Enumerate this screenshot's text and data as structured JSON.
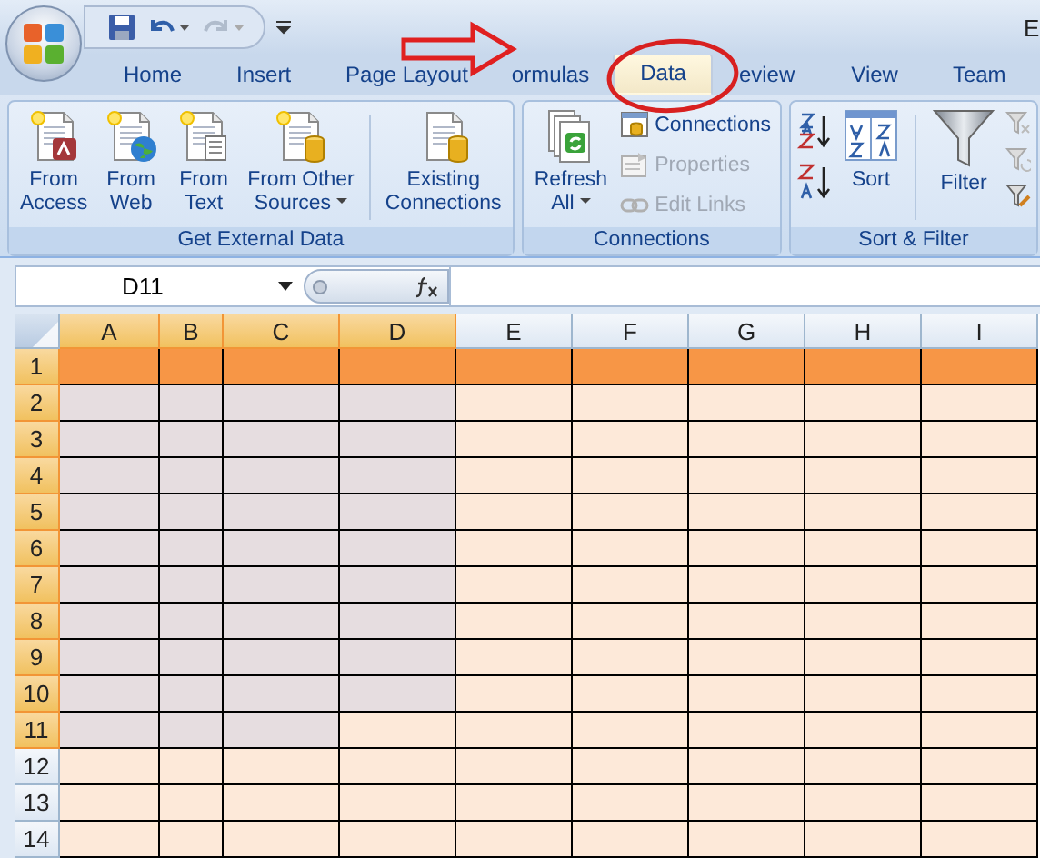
{
  "title_bar": {
    "title": "E"
  },
  "tabs": [
    {
      "label": "Home",
      "selected": false
    },
    {
      "label": "Insert",
      "selected": false
    },
    {
      "label": "Page Layout",
      "selected": false
    },
    {
      "label": "ormulas",
      "selected": false
    },
    {
      "label": "Data",
      "selected": true
    },
    {
      "label": "eview",
      "selected": false
    },
    {
      "label": "View",
      "selected": false
    },
    {
      "label": "Team",
      "selected": false
    }
  ],
  "ribbon": {
    "groups": [
      {
        "title": "Get External Data",
        "items": [
          {
            "kind": "large",
            "label": "From\nAccess",
            "dropdown": false,
            "disabled": false
          },
          {
            "kind": "large",
            "label": "From\nWeb",
            "dropdown": false,
            "disabled": false
          },
          {
            "kind": "large",
            "label": "From\nText",
            "dropdown": false,
            "disabled": false
          },
          {
            "kind": "large",
            "label": "From Other\nSources",
            "dropdown": true,
            "disabled": false
          },
          {
            "kind": "separator"
          },
          {
            "kind": "large",
            "label": "Existing\nConnections",
            "dropdown": false,
            "disabled": false
          }
        ]
      },
      {
        "title": "Connections",
        "items": [
          {
            "kind": "large",
            "label": "Refresh\nAll",
            "dropdown": true,
            "disabled": false
          },
          {
            "kind": "stack",
            "items": [
              {
                "label": "Connections",
                "disabled": false
              },
              {
                "label": "Properties",
                "disabled": true
              },
              {
                "label": "Edit Links",
                "disabled": true
              }
            ]
          }
        ]
      },
      {
        "title": "Sort & Filter",
        "items": [
          {
            "kind": "iconstack"
          },
          {
            "kind": "large",
            "label": "Sort",
            "dropdown": false,
            "disabled": false
          },
          {
            "kind": "separator"
          },
          {
            "kind": "large",
            "label": "Filter",
            "dropdown": false,
            "disabled": false
          },
          {
            "kind": "iconstack"
          }
        ]
      }
    ]
  },
  "formula_bar": {
    "name_box": "D11"
  },
  "grid": {
    "columns": [
      {
        "label": "A",
        "selected": true
      },
      {
        "label": "B",
        "selected": true
      },
      {
        "label": "C",
        "selected": true
      },
      {
        "label": "D",
        "selected": true
      },
      {
        "label": "E",
        "selected": false
      },
      {
        "label": "F",
        "selected": false
      },
      {
        "label": "G",
        "selected": false
      },
      {
        "label": "H",
        "selected": false
      },
      {
        "label": "I",
        "selected": false
      }
    ],
    "rows": [
      {
        "label": "1",
        "selected": true,
        "cells": [
          {
            "color": "#f79646"
          },
          {
            "color": "#f79646"
          },
          {
            "color": "#f79646"
          },
          {
            "color": "#f79646"
          },
          {
            "color": "#f79646"
          },
          {
            "color": "#f79646"
          },
          {
            "color": "#f79646"
          },
          {
            "color": "#f79646"
          },
          {
            "color": "#f79646"
          }
        ]
      },
      {
        "label": "2",
        "selected": true,
        "cells": [
          {
            "color": "#e6dde0"
          },
          {
            "color": "#e6dde0"
          },
          {
            "color": "#e6dde0"
          },
          {
            "color": "#e6dde0"
          },
          {
            "color": "#fde9d9"
          },
          {
            "color": "#fde9d9"
          },
          {
            "color": "#fde9d9"
          },
          {
            "color": "#fde9d9"
          },
          {
            "color": "#fde9d9"
          }
        ]
      },
      {
        "label": "3",
        "selected": true,
        "cells": [
          {
            "color": "#e6dde0"
          },
          {
            "color": "#e6dde0"
          },
          {
            "color": "#e6dde0"
          },
          {
            "color": "#e6dde0"
          },
          {
            "color": "#fde9d9"
          },
          {
            "color": "#fde9d9"
          },
          {
            "color": "#fde9d9"
          },
          {
            "color": "#fde9d9"
          },
          {
            "color": "#fde9d9"
          }
        ]
      },
      {
        "label": "4",
        "selected": true,
        "cells": [
          {
            "color": "#e6dde0"
          },
          {
            "color": "#e6dde0"
          },
          {
            "color": "#e6dde0"
          },
          {
            "color": "#e6dde0"
          },
          {
            "color": "#fde9d9"
          },
          {
            "color": "#fde9d9"
          },
          {
            "color": "#fde9d9"
          },
          {
            "color": "#fde9d9"
          },
          {
            "color": "#fde9d9"
          }
        ]
      },
      {
        "label": "5",
        "selected": true,
        "cells": [
          {
            "color": "#e6dde0"
          },
          {
            "color": "#e6dde0"
          },
          {
            "color": "#e6dde0"
          },
          {
            "color": "#e6dde0"
          },
          {
            "color": "#fde9d9"
          },
          {
            "color": "#fde9d9"
          },
          {
            "color": "#fde9d9"
          },
          {
            "color": "#fde9d9"
          },
          {
            "color": "#fde9d9"
          }
        ]
      },
      {
        "label": "6",
        "selected": true,
        "cells": [
          {
            "color": "#e6dde0"
          },
          {
            "color": "#e6dde0"
          },
          {
            "color": "#e6dde0"
          },
          {
            "color": "#e6dde0"
          },
          {
            "color": "#fde9d9"
          },
          {
            "color": "#fde9d9"
          },
          {
            "color": "#fde9d9"
          },
          {
            "color": "#fde9d9"
          },
          {
            "color": "#fde9d9"
          }
        ]
      },
      {
        "label": "7",
        "selected": true,
        "cells": [
          {
            "color": "#e6dde0"
          },
          {
            "color": "#e6dde0"
          },
          {
            "color": "#e6dde0"
          },
          {
            "color": "#e6dde0"
          },
          {
            "color": "#fde9d9"
          },
          {
            "color": "#fde9d9"
          },
          {
            "color": "#fde9d9"
          },
          {
            "color": "#fde9d9"
          },
          {
            "color": "#fde9d9"
          }
        ]
      },
      {
        "label": "8",
        "selected": true,
        "cells": [
          {
            "color": "#e6dde0"
          },
          {
            "color": "#e6dde0"
          },
          {
            "color": "#e6dde0"
          },
          {
            "color": "#e6dde0"
          },
          {
            "color": "#fde9d9"
          },
          {
            "color": "#fde9d9"
          },
          {
            "color": "#fde9d9"
          },
          {
            "color": "#fde9d9"
          },
          {
            "color": "#fde9d9"
          }
        ]
      },
      {
        "label": "9",
        "selected": true,
        "cells": [
          {
            "color": "#e6dde0"
          },
          {
            "color": "#e6dde0"
          },
          {
            "color": "#e6dde0"
          },
          {
            "color": "#e6dde0"
          },
          {
            "color": "#fde9d9"
          },
          {
            "color": "#fde9d9"
          },
          {
            "color": "#fde9d9"
          },
          {
            "color": "#fde9d9"
          },
          {
            "color": "#fde9d9"
          }
        ]
      },
      {
        "label": "10",
        "selected": true,
        "cells": [
          {
            "color": "#e6dde0"
          },
          {
            "color": "#e6dde0"
          },
          {
            "color": "#e6dde0"
          },
          {
            "color": "#e6dde0"
          },
          {
            "color": "#fde9d9"
          },
          {
            "color": "#fde9d9"
          },
          {
            "color": "#fde9d9"
          },
          {
            "color": "#fde9d9"
          },
          {
            "color": "#fde9d9"
          }
        ]
      },
      {
        "label": "11",
        "selected": true,
        "cells": [
          {
            "color": "#e6dde0"
          },
          {
            "color": "#e6dde0"
          },
          {
            "color": "#e6dde0"
          },
          {
            "color": "#fde9d9"
          },
          {
            "color": "#fde9d9"
          },
          {
            "color": "#fde9d9"
          },
          {
            "color": "#fde9d9"
          },
          {
            "color": "#fde9d9"
          },
          {
            "color": "#fde9d9"
          }
        ]
      },
      {
        "label": "12",
        "selected": false,
        "cells": [
          {
            "color": "#fde9d9"
          },
          {
            "color": "#fde9d9"
          },
          {
            "color": "#fde9d9"
          },
          {
            "color": "#fde9d9"
          },
          {
            "color": "#fde9d9"
          },
          {
            "color": "#fde9d9"
          },
          {
            "color": "#fde9d9"
          },
          {
            "color": "#fde9d9"
          },
          {
            "color": "#fde9d9"
          }
        ]
      },
      {
        "label": "13",
        "selected": false,
        "cells": [
          {
            "color": "#fde9d9"
          },
          {
            "color": "#fde9d9"
          },
          {
            "color": "#fde9d9"
          },
          {
            "color": "#fde9d9"
          },
          {
            "color": "#fde9d9"
          },
          {
            "color": "#fde9d9"
          },
          {
            "color": "#fde9d9"
          },
          {
            "color": "#fde9d9"
          },
          {
            "color": "#fde9d9"
          }
        ]
      },
      {
        "label": "14",
        "selected": false,
        "cells": [
          {
            "color": "#fde9d9"
          },
          {
            "color": "#fde9d9"
          },
          {
            "color": "#fde9d9"
          },
          {
            "color": "#fde9d9"
          },
          {
            "color": "#fde9d9"
          },
          {
            "color": "#fde9d9"
          },
          {
            "color": "#fde9d9"
          },
          {
            "color": "#fde9d9"
          },
          {
            "color": "#fde9d9"
          }
        ]
      }
    ]
  }
}
